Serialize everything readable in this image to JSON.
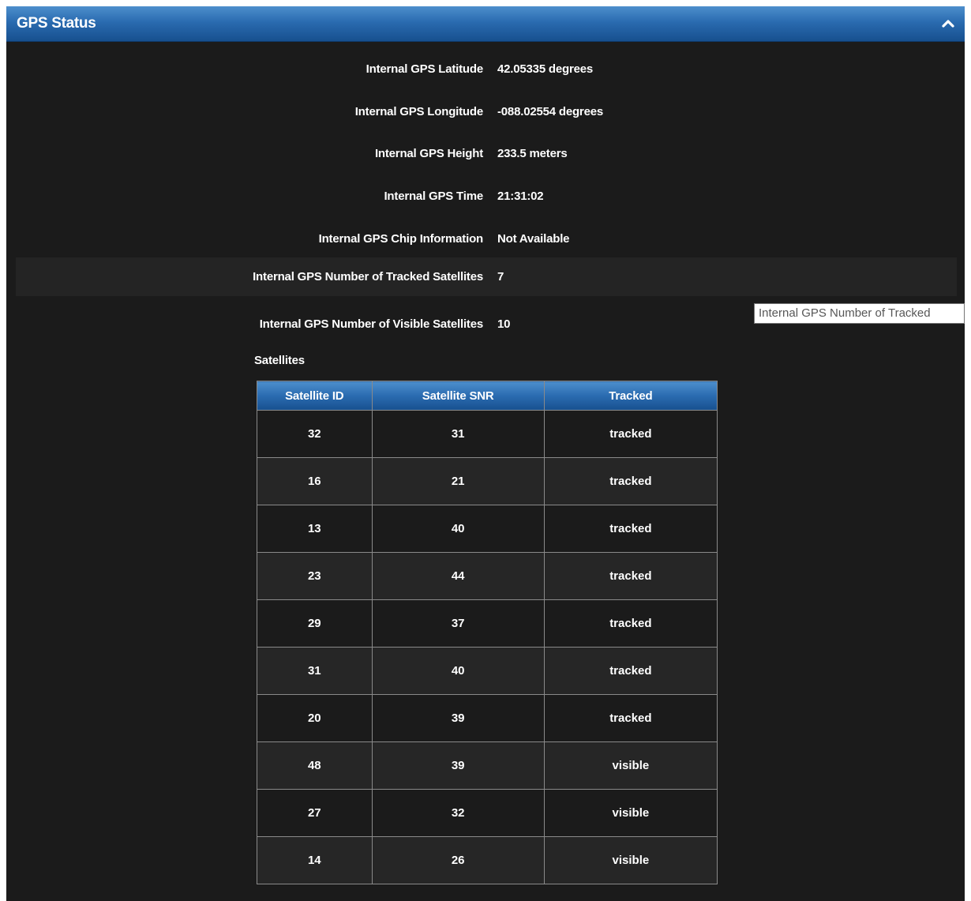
{
  "panel": {
    "title": "GPS Status",
    "collapse_icon": "chevron-up-icon"
  },
  "info": [
    {
      "label": "Internal GPS Latitude",
      "value": "42.05335 degrees"
    },
    {
      "label": "Internal GPS Longitude",
      "value": "-088.02554 degrees"
    },
    {
      "label": "Internal GPS Height",
      "value": "233.5 meters"
    },
    {
      "label": "Internal GPS Time",
      "value": "21:31:02"
    },
    {
      "label": "Internal GPS Chip Information",
      "value": "Not Available"
    },
    {
      "label": "Internal GPS Number of Tracked Satellites",
      "value": "7"
    },
    {
      "label": "Internal GPS Number of Visible Satellites",
      "value": "10"
    }
  ],
  "tooltip": {
    "text": "Internal GPS Number of Tracked"
  },
  "satellites": {
    "heading": "Satellites",
    "columns": [
      "Satellite ID",
      "Satellite SNR",
      "Tracked"
    ],
    "rows": [
      [
        "32",
        "31",
        "tracked"
      ],
      [
        "16",
        "21",
        "tracked"
      ],
      [
        "13",
        "40",
        "tracked"
      ],
      [
        "23",
        "44",
        "tracked"
      ],
      [
        "29",
        "37",
        "tracked"
      ],
      [
        "31",
        "40",
        "tracked"
      ],
      [
        "20",
        "39",
        "tracked"
      ],
      [
        "48",
        "39",
        "visible"
      ],
      [
        "27",
        "32",
        "visible"
      ],
      [
        "14",
        "26",
        "visible"
      ]
    ]
  },
  "colors": {
    "header_blue": "#2a6bb0",
    "panel_bg": "#1b1b1b",
    "row_alt": "#262626"
  }
}
